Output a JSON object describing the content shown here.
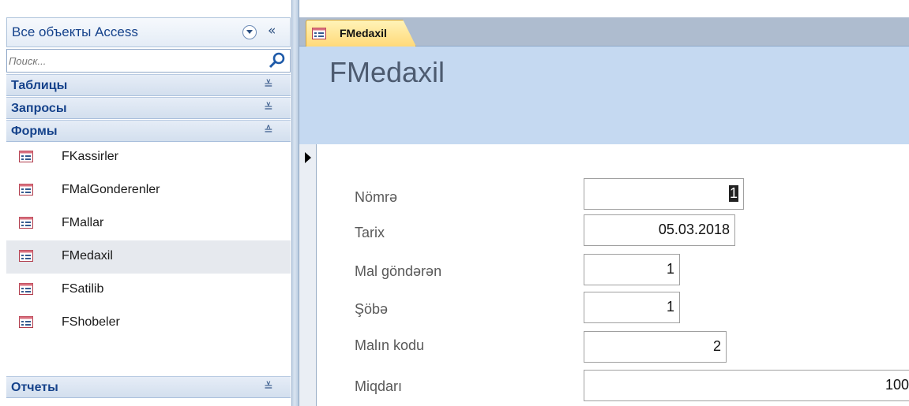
{
  "nav": {
    "title": "Все объекты Access",
    "collapse_glyph": "«",
    "search": {
      "placeholder": "Поиск...",
      "value": ""
    },
    "groups": {
      "tables": {
        "label": "Таблицы",
        "chevron": "≚"
      },
      "queries": {
        "label": "Запросы",
        "chevron": "≚"
      },
      "forms": {
        "label": "Формы",
        "chevron": "≙",
        "items": [
          {
            "label": "FKassirler",
            "icon": "form-icon"
          },
          {
            "label": "FMalGonderenler",
            "icon": "form-icon"
          },
          {
            "label": "FMallar",
            "icon": "form-icon"
          },
          {
            "label": "FMedaxil",
            "icon": "form-icon",
            "selected": true
          },
          {
            "label": "FSatilib",
            "icon": "form-icon"
          },
          {
            "label": "FShobeler",
            "icon": "form-icon"
          }
        ]
      },
      "reports": {
        "label": "Отчеты",
        "chevron": "≚"
      }
    }
  },
  "tab": {
    "label": "FMedaxil",
    "icon": "form-icon"
  },
  "form": {
    "title": "FMedaxil",
    "fields": [
      {
        "label": "Nömrə",
        "value": "1"
      },
      {
        "label": "Tarix",
        "value": "05.03.2018"
      },
      {
        "label": "Mal göndərən",
        "value": "1"
      },
      {
        "label": "Şöbə",
        "value": "1"
      },
      {
        "label": "Malın kodu",
        "value": "2"
      },
      {
        "label": "Miqdarı",
        "value": "100"
      }
    ]
  },
  "colors": {
    "header_bg": "#c5d9f1",
    "tab_bg": "#ffd979",
    "nav_text": "#15428b"
  }
}
